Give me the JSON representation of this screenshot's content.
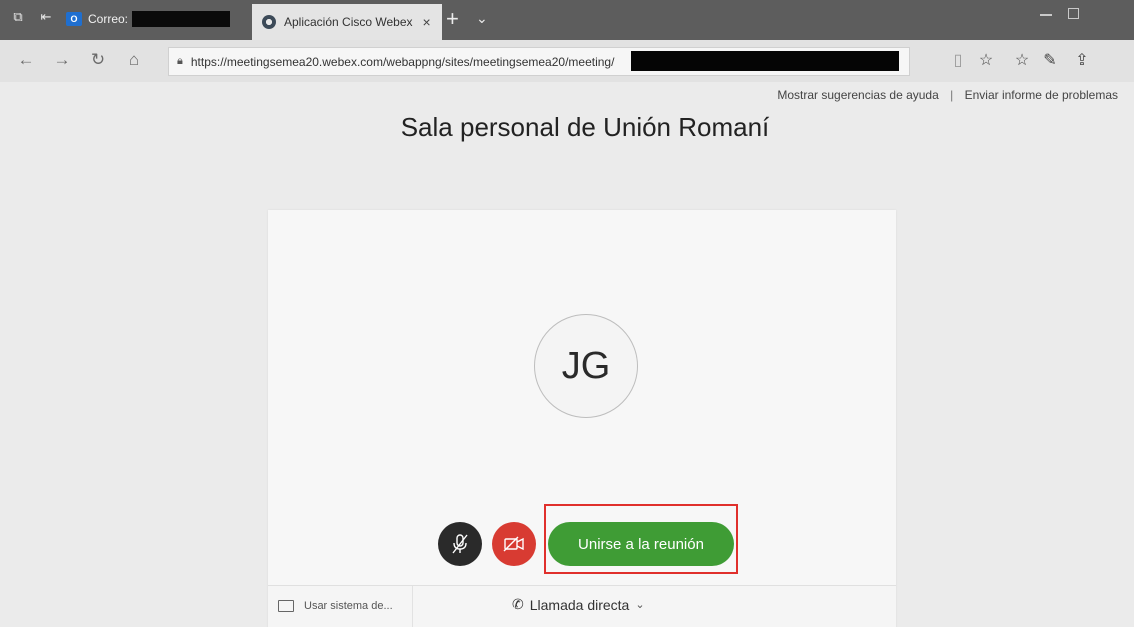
{
  "browser": {
    "tabs": [
      {
        "label": "Correo:"
      },
      {
        "label": "Aplicación Cisco Webex",
        "close": "×"
      }
    ],
    "new_tab": "+",
    "tab_menu": "⌄",
    "address": {
      "url": "https://meetingsemea20.webex.com/webappng/sites/meetingsemea20/meeting/"
    }
  },
  "page": {
    "help_link": "Mostrar sugerencias de ayuda",
    "separator": "|",
    "report_link": "Enviar informe de problemas",
    "title": "Sala personal de Unión Romaní",
    "avatar_initials": "JG",
    "join_button": "Unirse a la reunión",
    "footer": {
      "audio_system": "Usar sistema de...",
      "direct_call": "Llamada directa"
    }
  },
  "colors": {
    "join": "#3f9c35",
    "video_off": "#d83b32",
    "mute": "#2a2a2a",
    "highlight": "#e0302c"
  }
}
